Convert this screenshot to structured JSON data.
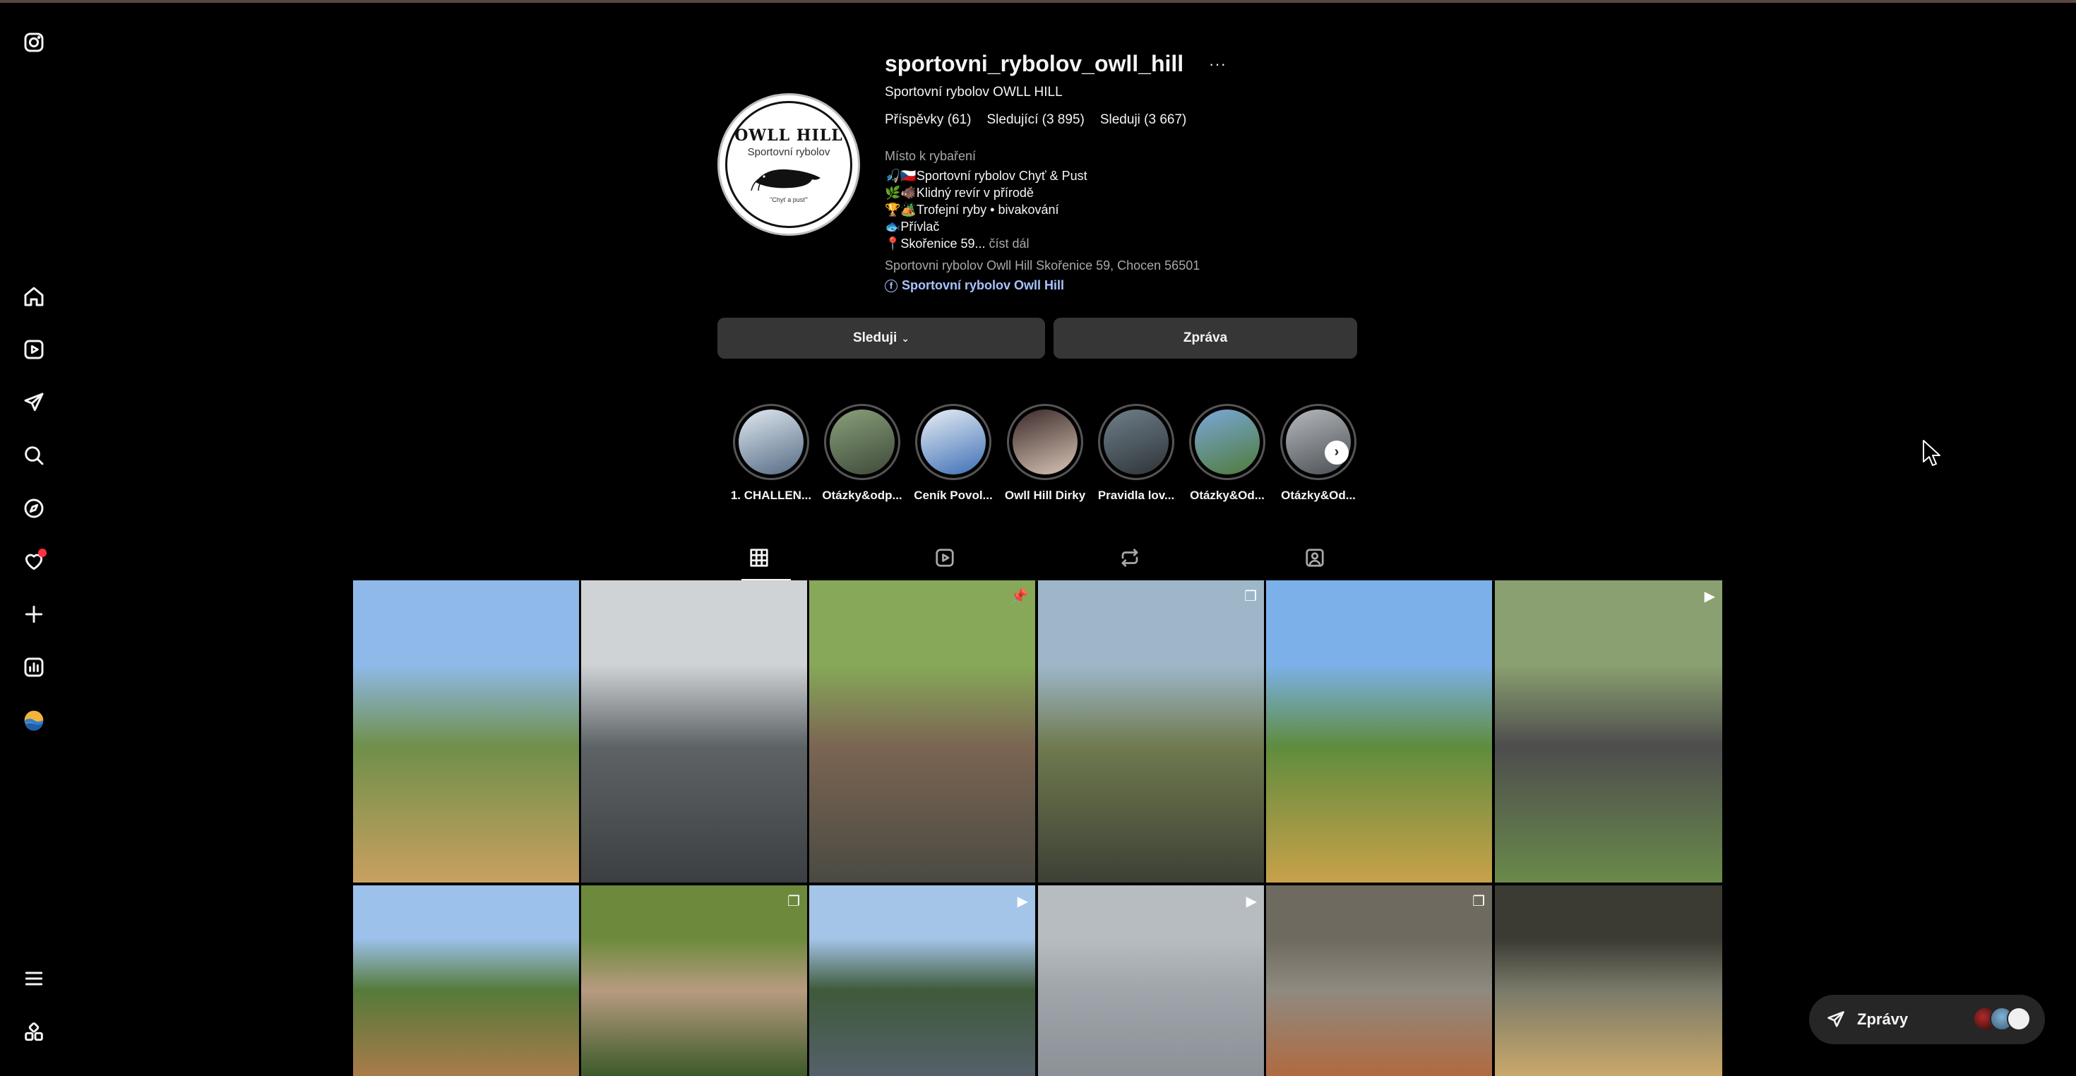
{
  "profile": {
    "username": "sportovni_rybolov_owll_hill",
    "more": "···",
    "full_name": "Sportovní rybolov OWLL HILL",
    "stats": {
      "posts": "Příspěvky (61)",
      "followers": "Sledující (3 895)",
      "following": "Sleduji (3 667)"
    },
    "category": "Místo k rybaření",
    "bio_lines": [
      "🎣🇨🇿Sportovní rybolov Chyť & Pust",
      "🌿🐗Klidný revír v přírodě",
      "🏆🏕️Trofejní ryby • bivakování",
      "🐟Přívlač",
      "📍Skořenice 59..."
    ],
    "read_more": "číst dál",
    "address": "Sportovni rybolov Owll Hill Skořenice 59, Chocen 56501",
    "facebook_link": "Sportovní rybolov Owll Hill",
    "logo": {
      "title": "OWLL HILL",
      "subtitle": "Sportovní rybolov",
      "motto": "\"Chyť a pusť\""
    }
  },
  "actions": {
    "follow_label": "Sleduji",
    "message_label": "Zpráva"
  },
  "highlights": [
    {
      "label": "1. CHALLEN..."
    },
    {
      "label": "Otázky&odp..."
    },
    {
      "label": "Ceník Povol..."
    },
    {
      "label": "Owll Hill Dirky"
    },
    {
      "label": "Pravidla lov..."
    },
    {
      "label": "Otázky&Od..."
    },
    {
      "label": "Otázky&Od..."
    }
  ],
  "tabs": [
    "posts-grid-icon",
    "reels-icon",
    "reposts-icon",
    "tagged-icon"
  ],
  "posts": [
    {
      "icon": "",
      "colors": [
        "#8fb9e8",
        "#6f8f4a",
        "#c9a060"
      ]
    },
    {
      "icon": "",
      "colors": [
        "#cfd3d6",
        "#5e6366",
        "#3c3f42"
      ]
    },
    {
      "icon": "pin-icon",
      "colors": [
        "#86a858",
        "#7b6553",
        "#4a4a42"
      ]
    },
    {
      "icon": "carousel-icon",
      "colors": [
        "#9db7c9",
        "#6f7a4f",
        "#3d4035"
      ]
    },
    {
      "icon": "",
      "colors": [
        "#7bb1e8",
        "#5f8c3e",
        "#c9a14a"
      ]
    },
    {
      "icon": "reel-icon",
      "colors": [
        "#8aa070",
        "#4d4d4d",
        "#6a8a4a"
      ]
    },
    {
      "icon": "",
      "colors": [
        "#9cc1ea",
        "#557a3a",
        "#a87b4a"
      ]
    },
    {
      "icon": "carousel-icon",
      "colors": [
        "#6d8a3c",
        "#b79b80",
        "#3d5a2a"
      ]
    },
    {
      "icon": "reel-icon",
      "colors": [
        "#a4c4e8",
        "#3f5a3a",
        "#55606a"
      ]
    },
    {
      "icon": "reel-icon",
      "colors": [
        "#b7bcc0",
        "#9fa5aa",
        "#8b9196"
      ]
    },
    {
      "icon": "carousel-icon",
      "colors": [
        "#6f6a60",
        "#8f8a80",
        "#b06a40"
      ]
    },
    {
      "icon": "",
      "colors": [
        "#3b3a33",
        "#7a7a6a",
        "#c9a86a"
      ]
    }
  ],
  "messages_widget": {
    "label": "Zprávy"
  },
  "colors": {
    "background": "#000000",
    "button": "#363636",
    "link": "#a8c3ff",
    "notification": "#ff3040"
  }
}
